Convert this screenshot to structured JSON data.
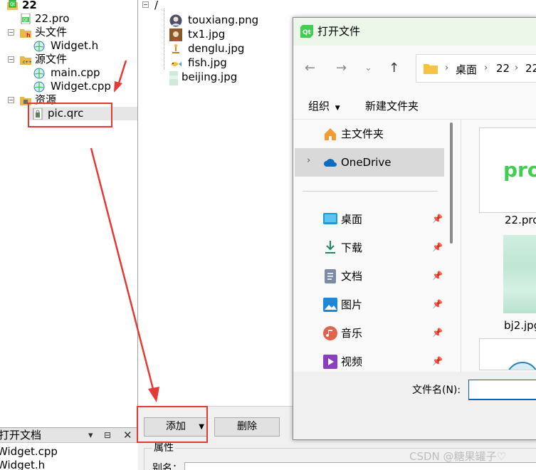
{
  "project_tree": {
    "project_name": "22",
    "pro_file": "22.pro",
    "headers_folder": "头文件",
    "header_file": "Widget.h",
    "sources_folder": "源文件",
    "source_files": [
      "main.cpp",
      "Widget.cpp"
    ],
    "resources_folder": "资源",
    "resource_file": "pic.qrc"
  },
  "open_documents": {
    "title": "打开文档",
    "items": [
      "Widget.cpp",
      "Widget.h"
    ]
  },
  "resource_editor": {
    "prefix": "/",
    "files": [
      "touxiang.png",
      "tx1.jpg",
      "denglu.jpg",
      "fish.jpg",
      "beijing.jpg"
    ],
    "add_button": "添加",
    "remove_button": "删除",
    "properties_label": "属性",
    "alias_label": "别名："
  },
  "file_dialog": {
    "title": "打开文件",
    "breadcrumb": [
      "桌面",
      "22",
      "22"
    ],
    "organize_label": "组织",
    "new_folder_label": "新建文件夹",
    "home_label": "主文件夹",
    "onedrive_label": "OneDrive",
    "quick_access": [
      "桌面",
      "下载",
      "文档",
      "图片",
      "音乐",
      "视频"
    ],
    "files": [
      "22.pro",
      "bj2.jpg"
    ],
    "pro_thumb_text": "pro",
    "filename_label": "文件名(N):",
    "filename_value": ""
  },
  "watermark": "CSDN @糖果罐子♡",
  "colors": {
    "annotation_red": "#e53935",
    "dialog_title_bg": "#ecf7e9",
    "qt_green": "#41cd52"
  }
}
